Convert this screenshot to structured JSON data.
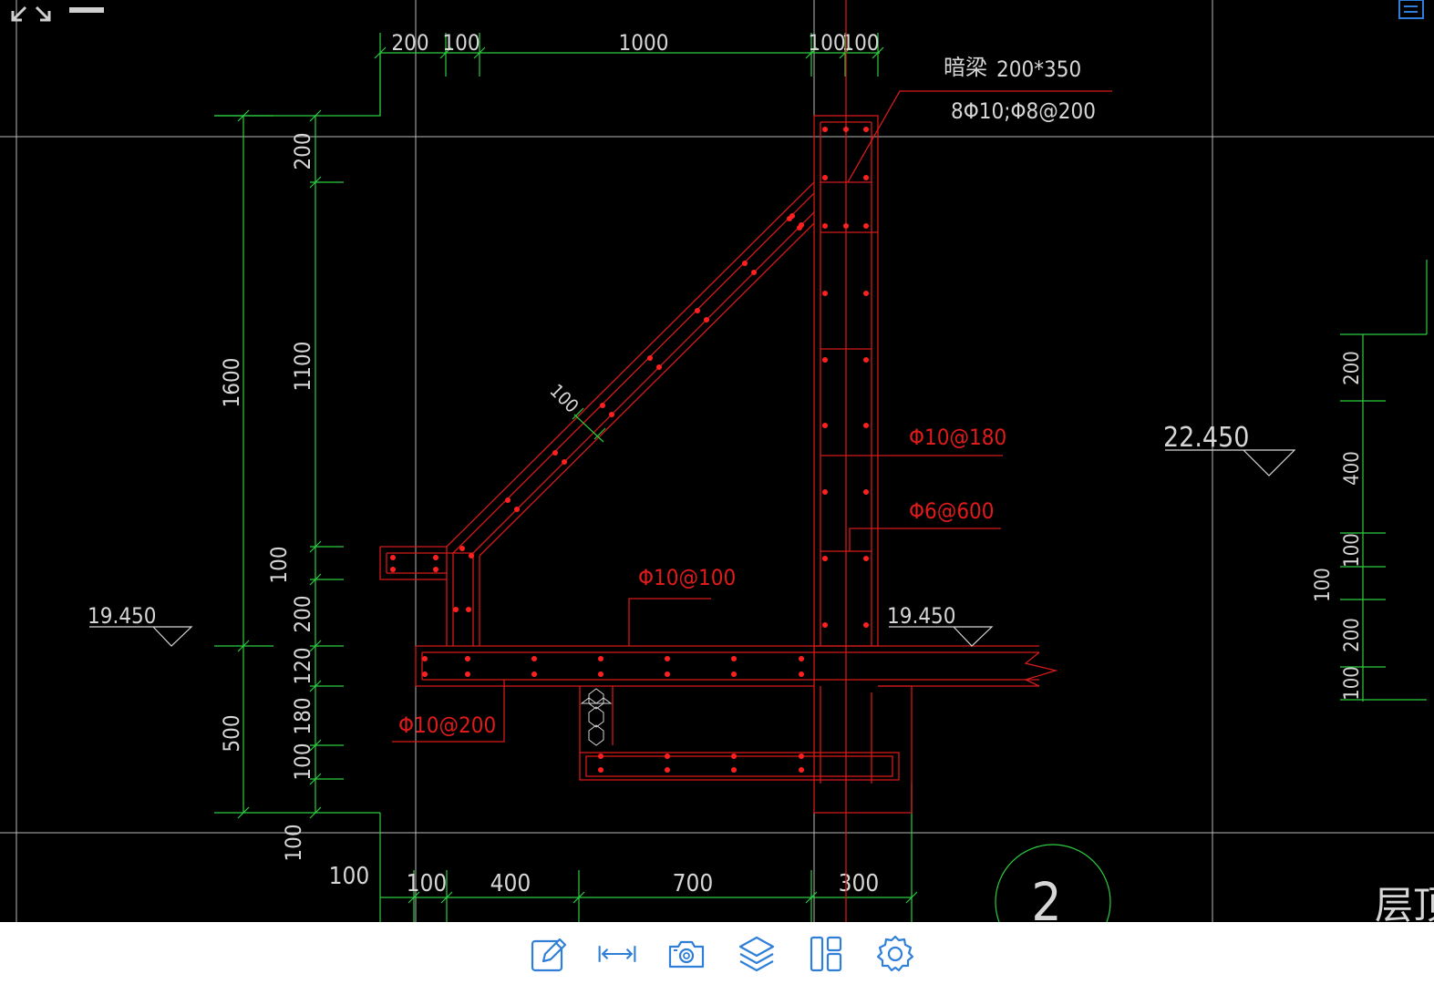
{
  "app": {
    "toolbar": {
      "buttons": [
        {
          "name": "annotate",
          "icon": "pencil-edit-icon"
        },
        {
          "name": "measure",
          "icon": "dimension-measure-icon"
        },
        {
          "name": "screenshot",
          "icon": "camera-icon"
        },
        {
          "name": "layers",
          "icon": "layers-icon"
        },
        {
          "name": "layout",
          "icon": "layout-panels-icon"
        },
        {
          "name": "settings",
          "icon": "gear-icon"
        }
      ],
      "accent_color": "#2f7fd8"
    },
    "window_controls": {
      "expand_icon": "arrows-expand-icon",
      "minimize_icon": "minimize-bar-icon"
    }
  },
  "drawing": {
    "colors": {
      "dimension": "#2ecc40",
      "rebar": "#e01b1b",
      "grid": "#c8c8c8",
      "text": "#d6d6d6",
      "annotation": "#e01b1b"
    },
    "top_dims": [
      "200",
      "100",
      "1000",
      "100",
      "100"
    ],
    "bottom_dims": [
      "100",
      "100",
      "400",
      "700",
      "300"
    ],
    "left_dims_outer": [
      "1600",
      "500"
    ],
    "left_dims_inner": [
      "200",
      "1100",
      "100",
      "200",
      "120",
      "180",
      "100",
      "100"
    ],
    "right_dims": [
      "200",
      "400",
      "100",
      "100",
      "200",
      "100"
    ],
    "slope_dim": "100",
    "beam_label": "暗梁",
    "beam_size": "200*350",
    "beam_rebar": "8Φ10;Φ8@200",
    "callouts": [
      "Φ10@180",
      "Φ6@600",
      "Φ10@100",
      "Φ10@200"
    ],
    "elevations": [
      "19.450",
      "19.450",
      "22.450"
    ],
    "grid_bubble": "2",
    "partial_title": "层顶"
  }
}
